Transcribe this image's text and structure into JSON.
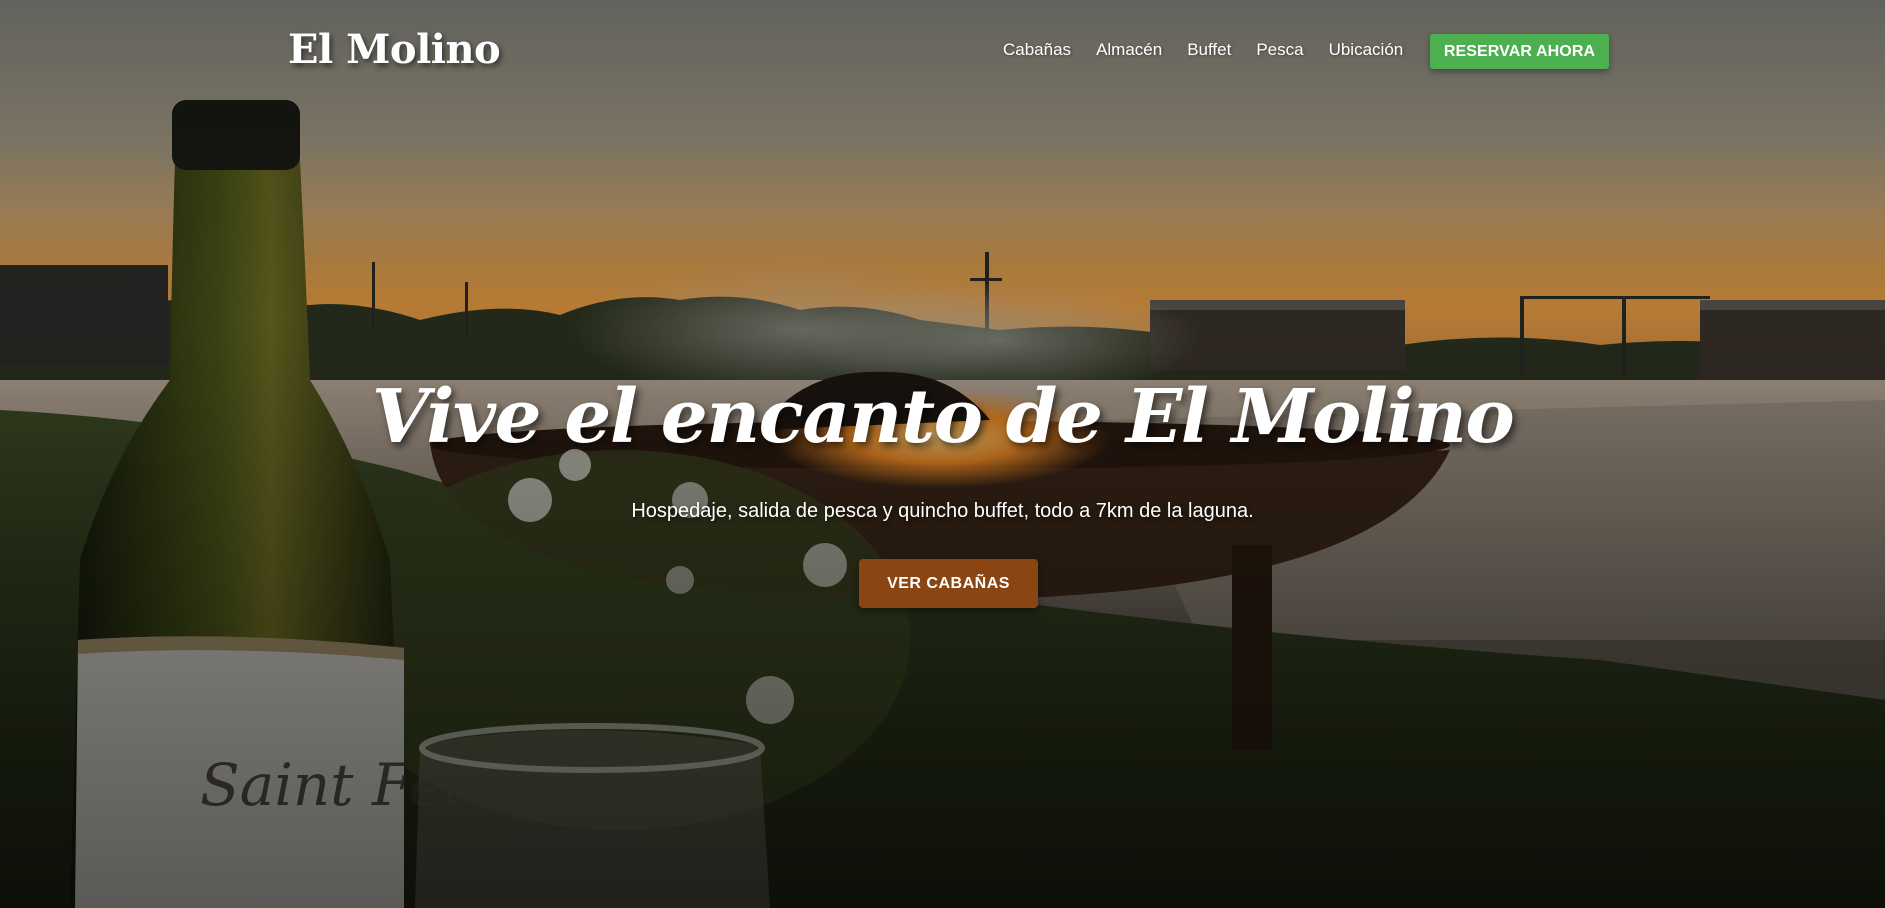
{
  "header": {
    "logo": "El Molino",
    "nav": [
      {
        "label": "Cabañas"
      },
      {
        "label": "Almacén"
      },
      {
        "label": "Buffet"
      },
      {
        "label": "Pesca"
      },
      {
        "label": "Ubicación"
      }
    ],
    "cta_label": "RESERVAR AHORA"
  },
  "hero": {
    "title": "Vive el encanto de El Molino",
    "subtitle": "Hospedaje, salida de pesca y quincho buffet, todo a 7km de la laguna.",
    "button_label": "VER CABAÑAS",
    "background_scene": "sunset-lake-firepit-wine-bottle"
  },
  "colors": {
    "cta_green": "#4caf50",
    "hero_button_brown": "#8b4513",
    "text": "#ffffff"
  }
}
